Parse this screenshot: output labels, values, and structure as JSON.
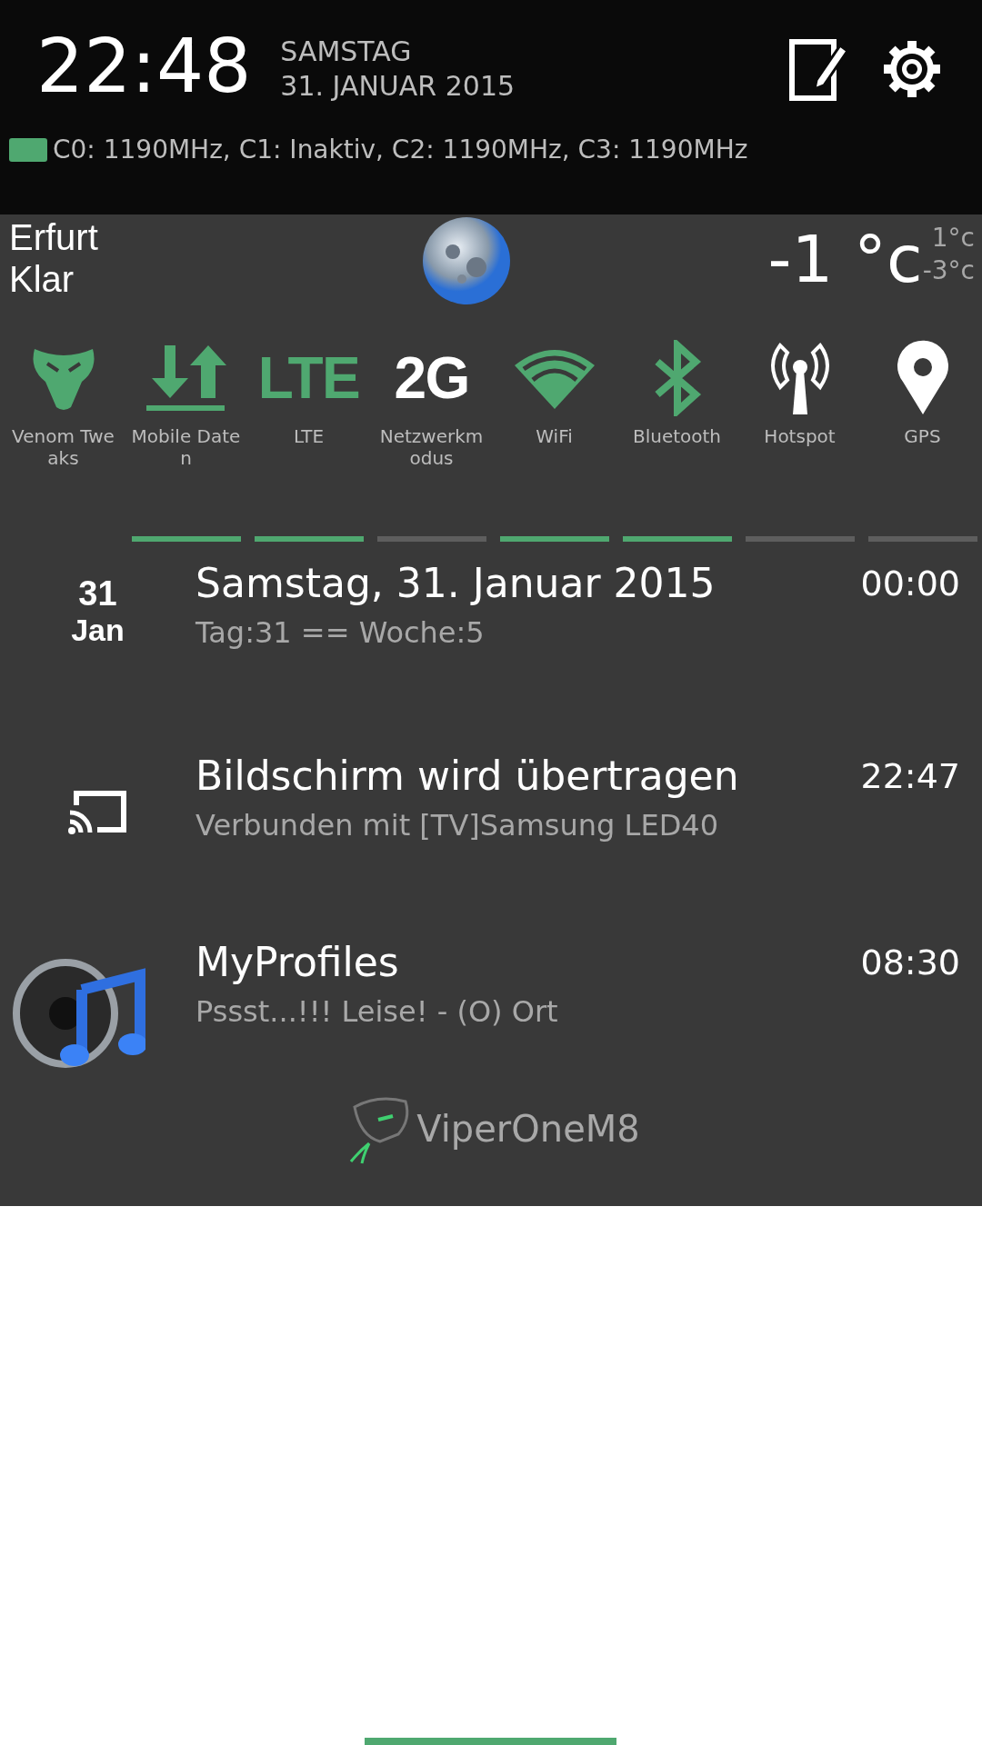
{
  "header": {
    "clock": "22:48",
    "weekday": "SAMSTAG",
    "date": "31. JANUAR 2015",
    "cpu": "C0: 1190MHz, C1: Inaktiv, C2: 1190MHz, C3: 1190MHz"
  },
  "weather": {
    "city": "Erfurt",
    "condition": "Klar",
    "temperature": "-1 °c",
    "high": "1°c",
    "low": "-3°c"
  },
  "toggles": [
    {
      "kind": "venom",
      "label": "Venom Tweaks"
    },
    {
      "kind": "data",
      "label": "Mobile Daten",
      "on": true
    },
    {
      "kind": "text",
      "glyph": "LTE",
      "label": "LTE",
      "on": true
    },
    {
      "kind": "text",
      "glyph": "2G",
      "label": "Netzwerkmodus",
      "on": false
    },
    {
      "kind": "wifi",
      "label": "WiFi",
      "on": true
    },
    {
      "kind": "bluetooth",
      "label": "Bluetooth",
      "on": true
    },
    {
      "kind": "hotspot",
      "label": "Hotspot",
      "on": false
    },
    {
      "kind": "gps",
      "label": "GPS",
      "on": false
    }
  ],
  "notifications": [
    {
      "kind": "calendar",
      "day": "31",
      "month": "Jan",
      "title": "Samstag, 31. Januar 2015",
      "text": "Tag:31 == Woche:5",
      "time": "00:00"
    },
    {
      "kind": "cast",
      "title": "Bildschirm wird übertragen",
      "text": "Verbunden mit [TV]Samsung LED40",
      "time": "22:47"
    },
    {
      "kind": "speaker",
      "title": "MyProfiles",
      "text": "Pssst...!!! Leise! - (O) Ort",
      "time": "08:30"
    }
  ],
  "footer": {
    "brand": "ViperOneM8"
  }
}
